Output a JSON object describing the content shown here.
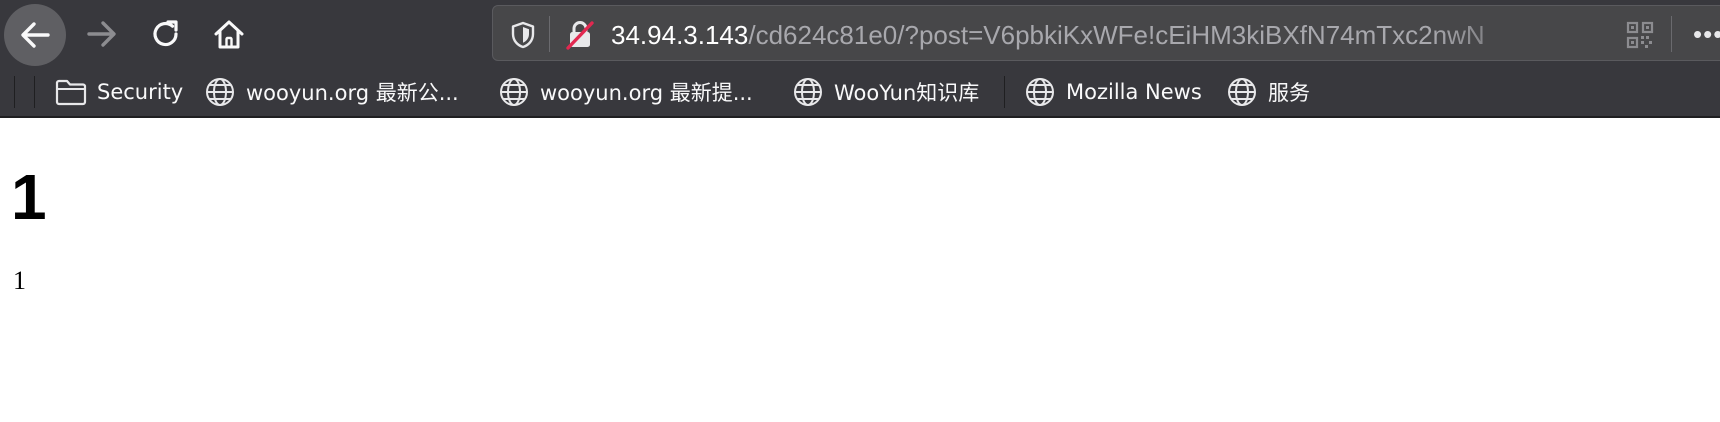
{
  "browser": {
    "nav": {
      "back_icon": "arrow-left-icon",
      "forward_icon": "arrow-right-icon",
      "reload_icon": "reload-icon",
      "home_icon": "home-icon"
    },
    "urlbar": {
      "host": "34.94.3.143",
      "path": "/cd624c81e0/?post=V6pbkiKxWFe!cEiHM3kiBXfN74mTxc2nwN",
      "shield_icon": "tracking-protection-shield-icon",
      "lock_icon": "insecure-lock-icon",
      "qr_icon": "qr-code-icon",
      "more_label": "•••"
    },
    "bookmarks": [
      {
        "label": "Security",
        "icon": "folder-icon"
      },
      {
        "label": "wooyun.org 最新公...",
        "icon": "globe-icon"
      },
      {
        "label": "wooyun.org 最新提...",
        "icon": "globe-icon"
      },
      {
        "label": "WooYun知识库",
        "icon": "globe-icon"
      },
      {
        "label": "Mozilla News",
        "icon": "globe-icon"
      },
      {
        "label": "服务",
        "icon": "globe-icon"
      }
    ]
  },
  "page": {
    "heading": "1",
    "body_text": "1"
  },
  "colors": {
    "toolbar": "#38383d",
    "urlbar": "#474749",
    "insecure_slash": "#e22850",
    "page_background": "#ffffff"
  }
}
